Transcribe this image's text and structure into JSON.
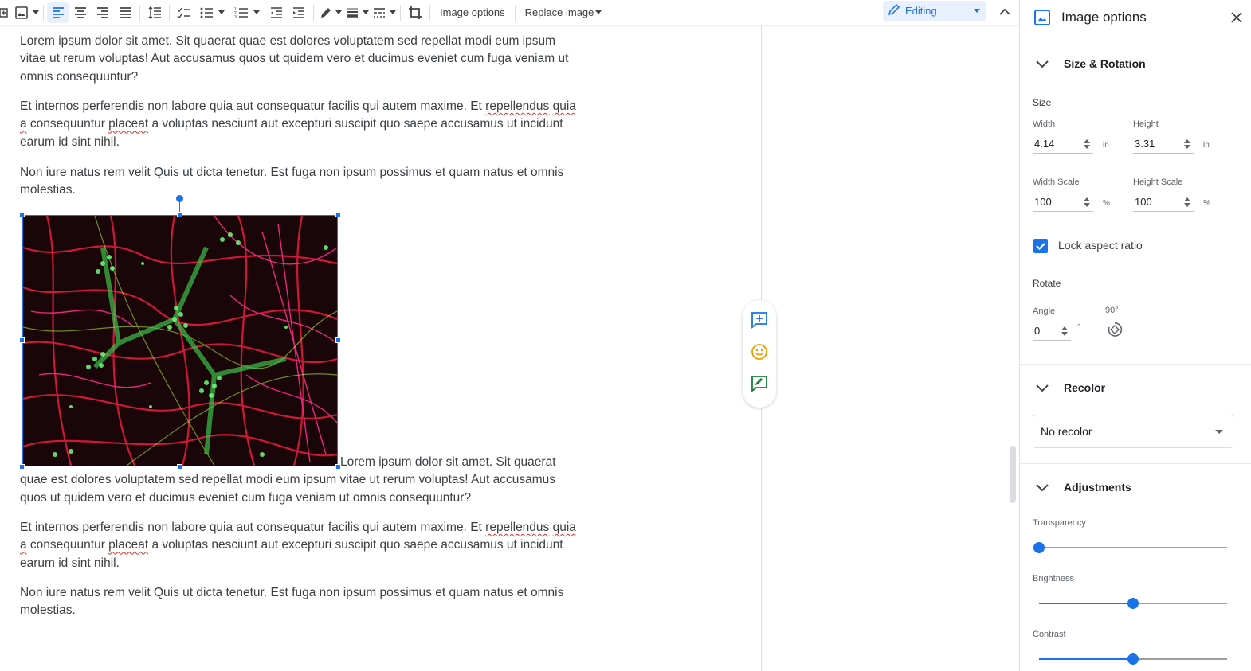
{
  "toolbar": {
    "image_options_label": "Image options",
    "replace_image_label": "Replace image",
    "mode_label": "Editing",
    "icons": [
      "insert-icon",
      "image-icon",
      "align-left-icon",
      "align-center-icon",
      "align-right-icon",
      "align-justify-icon",
      "line-spacing-icon",
      "checklist-icon",
      "bulleted-list-icon",
      "numbered-list-icon",
      "decrease-indent-icon",
      "increase-indent-icon",
      "border-color-icon",
      "border-weight-icon",
      "border-dash-icon",
      "crop-icon",
      "pencil-icon",
      "chevron-up-icon"
    ]
  },
  "document": {
    "paragraphs": [
      "Lorem ipsum dolor sit amet. Sit quaerat quae est dolores voluptatem sed repellat modi eum ipsum vitae ut rerum voluptas! Aut accusamus quos ut quidem vero et ducimus eveniet cum fuga veniam ut omnis consequuntur?",
      "Et internos perferendis non labore quia aut consequatur facilis qui autem maxime. Et ",
      "repellendus",
      "quia a",
      " consequuntur ",
      "placeat",
      " a voluptas nesciunt aut excepturi suscipit quo saepe accusamus ut incidunt earum id sint nihil.",
      "Non iure natus rem velit Quis ut dicta tenetur. Est fuga non ipsum possimus et quam natus et omnis molestias.",
      "Lorem ipsum dolor sit amet. Sit quaerat quae est dolores voluptatem sed repellat modi eum ipsum vitae ut rerum voluptas! Aut accusamus quos ut quidem vero et ducimus eveniet cum fuga veniam ut omnis consequuntur?"
    ]
  },
  "side_actions": [
    "add-comment-icon",
    "emoji-reaction-icon",
    "suggest-edits-icon"
  ],
  "panel": {
    "title": "Image options",
    "size_rotation": {
      "label": "Size & Rotation",
      "size_label": "Size",
      "width_label": "Width",
      "width_value": "4.14",
      "width_unit": "in",
      "height_label": "Height",
      "height_value": "3.31",
      "height_unit": "in",
      "width_scale_label": "Width Scale",
      "width_scale_value": "100",
      "height_scale_label": "Height Scale",
      "height_scale_value": "100",
      "scale_unit": "%",
      "lock_aspect_label": "Lock aspect ratio",
      "lock_aspect_checked": true,
      "rotate_label": "Rotate",
      "angle_label": "Angle",
      "angle_value": "0",
      "angle_unit": "°",
      "rotate_90_label": "90°"
    },
    "recolor": {
      "label": "Recolor",
      "selected": "No recolor"
    },
    "adjustments": {
      "label": "Adjustments",
      "transparency_label": "Transparency",
      "transparency_value": 0,
      "brightness_label": "Brightness",
      "brightness_value": 0.5,
      "contrast_label": "Contrast",
      "contrast_value": 0.5
    }
  },
  "colors": {
    "accent": "#1a73e8",
    "emoji": "#f29900",
    "suggest": "#188038"
  }
}
